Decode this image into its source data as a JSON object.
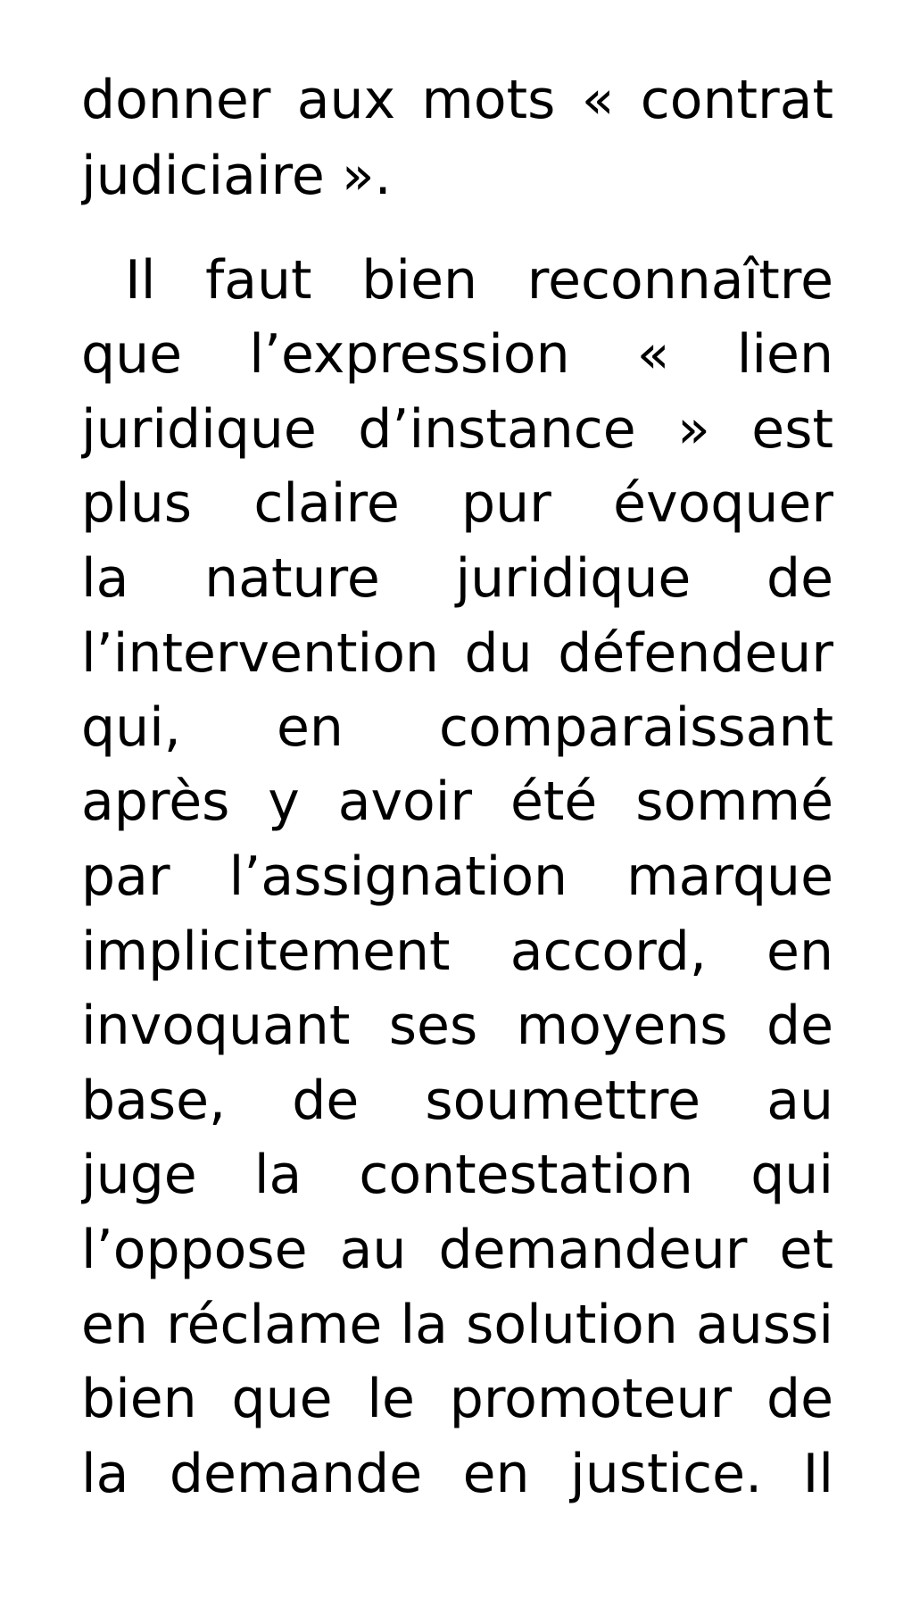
{
  "document": {
    "paragraph_1": {
      "lines": [
        "donner aux mots « contrat",
        "judiciaire »."
      ]
    },
    "paragraph_2": {
      "lines": [
        "Il faut bien reconnaître",
        "que l’expression « lien",
        "juridique d’instance » est",
        "plus claire pur évoquer",
        "la nature juridique de",
        "l’intervention du défendeur",
        "qui, en comparaissant",
        "après y avoir été sommé",
        "par l’assignation marque",
        "implicitement accord, en",
        "invoquant ses moyens de",
        "base, de soumettre au",
        "juge la contestation qui",
        "l’oppose au demandeur et",
        "en réclame la solution aussi",
        "bien que le promoteur de",
        "la demande en justice. Il"
      ]
    }
  }
}
